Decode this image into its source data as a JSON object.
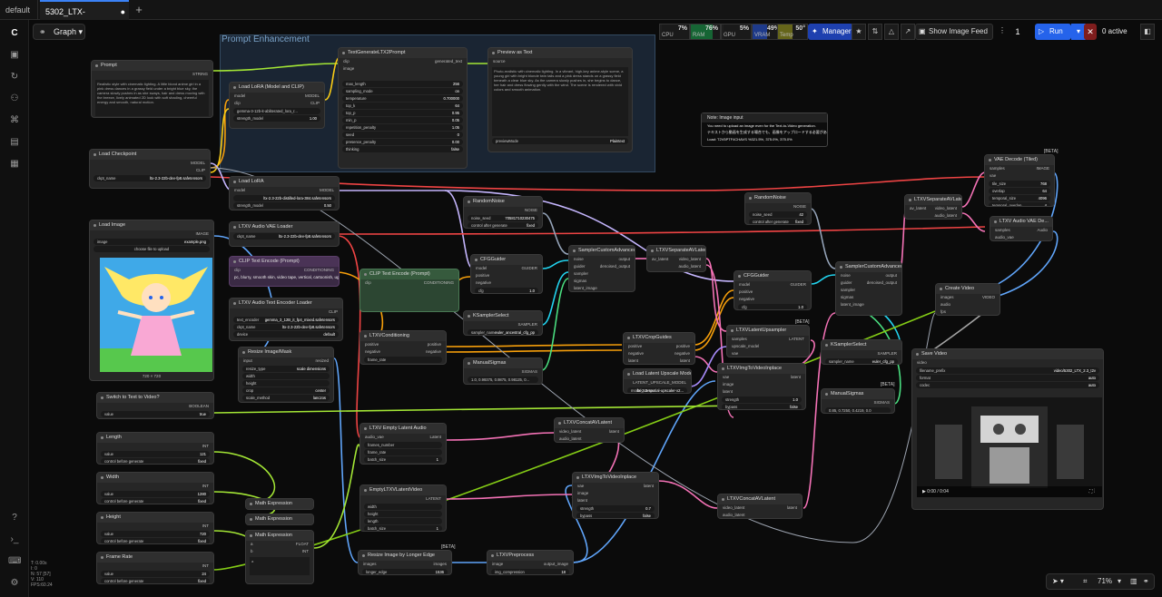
{
  "tabs": {
    "home": "default",
    "workflow": "5302_LTX-2.3_T2V_...",
    "modified_dot": "●",
    "add": "+"
  },
  "toolbar": {
    "graph_label": "Graph",
    "manager_label": "Manager",
    "feed_label": "Show Image Feed",
    "queue_count": "1",
    "run_label": "Run",
    "active_label": "0 active"
  },
  "meters": [
    {
      "label": "CPU",
      "value": "7%",
      "color": "#1f1f1f"
    },
    {
      "label": "RAM",
      "value": "76%",
      "color": "#166534"
    },
    {
      "label": "GPU",
      "value": "5%",
      "color": "#1f1f1f"
    },
    {
      "label": "VRAM",
      "value": "49%",
      "color": "#1e3a8a"
    },
    {
      "label": "Temp",
      "value": "50°",
      "color": "#65651a"
    }
  ],
  "group": {
    "title": "Prompt Enhancement"
  },
  "nodes": {
    "prompt": {
      "title": "Prompt",
      "out": "STRING",
      "text": "Realistic style with cinematic lighting. A little blond anime girl in a pink dress dances in a grassy field under a bright blue sky, the camera slowly pushes in as she sways, hair and dress moving with the breeze, lively animated 2D look with soft shading, cheerful energy and smooth, natural motion."
    },
    "textgen": {
      "title": "TextGenerateLTX2Prompt",
      "in": [
        "clip",
        "image"
      ],
      "out": "generated_text",
      "rows": [
        [
          "max_length",
          "256"
        ],
        [
          "sampling_mode",
          "on"
        ],
        [
          "temperature",
          "0.700000"
        ],
        [
          "top_k",
          "64"
        ],
        [
          "top_p",
          "0.95"
        ],
        [
          "min_p",
          "0.05"
        ],
        [
          "repetition_penalty",
          "1.05"
        ],
        [
          "seed",
          "0"
        ],
        [
          "presence_penalty",
          "0.00"
        ],
        [
          "thinking",
          "false"
        ]
      ]
    },
    "preview": {
      "title": "Preview as Text",
      "in": "source",
      "text": "Photo-realistic with cinematic lighting. In a vibrant, high-key anime-style scene, a young girl with bright blonde twin tails and a pink dress stands on a grassy field beneath a clear blue sky. As the camera slowly pushes in, she begins to dance, her hair and dress flowing gently with the wind. The scene is rendered with vivid colors and smooth animation.",
      "mode": "previewMode",
      "mode_val": "Plaintext"
    },
    "loralora": {
      "title": "Load LoRA (Model and CLIP)",
      "in": [
        "model",
        "clip"
      ],
      "out": [
        "MODEL",
        "CLIP"
      ],
      "lora": "gemma-3-12b-it-abliterated_lora_r...",
      "sm": "strength_model",
      "smv": "1.00",
      "sc": "strength_clip",
      "scv": "1.00"
    },
    "checkpoint": {
      "title": "Load Checkpoint",
      "out": [
        "MODEL",
        "CLIP",
        "VAE"
      ],
      "ckpt": "ckpt_name",
      "ckptv": "ltx-2.3-22b-dev-fp8.safetensors"
    },
    "loadlora": {
      "title": "Load LoRA",
      "in": "model",
      "out": "MODEL",
      "lora": "lora_name",
      "lorav": "ltx-2.3-22b-distilled-lora-384.safetensors",
      "str": "strength_model",
      "strv": "0.50"
    },
    "audiovae": {
      "title": "LTXV Audio VAE Loader",
      "out": "Audio VAE",
      "ckpt": "ckpt_name",
      "ckptv": "ltx-2.3-22b-dev-fp8.safetensors"
    },
    "loadimage": {
      "title": "Load Image",
      "out": [
        "IMAGE",
        "MASK"
      ],
      "image": "image",
      "imagev": "example.png",
      "upload": "choose file to upload",
      "dims": "720 × 720"
    },
    "clipenc": {
      "title": "CLIP Text Encode (Prompt)",
      "in": "clip",
      "out": "CONDITIONING",
      "text": "pc, blurry, smooth skin, video tape, vertical, cartoonish, ugly"
    },
    "clipenc2": {
      "title": "CLIP Text Encode (Prompt)",
      "in": "clip",
      "out": "CONDITIONING"
    },
    "audiotext": {
      "title": "LTXV Audio Text Encoder Loader",
      "out": "CLIP",
      "t1": "text_encoder",
      "t1v": "gemma_3_12B_it_fp4_mixed.safetensors",
      "t2": "ckpt_name",
      "t2v": "ltx-2.3-22b-dev-fp8.safetensors",
      "dev": "device",
      "devv": "default"
    },
    "resize": {
      "title": "Resize Image/Mask",
      "in": "input",
      "out": "resized",
      "rows": [
        [
          "resize_type",
          "scale dimensions"
        ],
        [
          "width",
          ""
        ],
        [
          "height",
          ""
        ],
        [
          "crop",
          "center"
        ],
        [
          "scale_method",
          "lanczos"
        ]
      ]
    },
    "switch": {
      "title": "Switch to Text to Video?",
      "out": "BOOLEAN",
      "val": "value",
      "valv": "true"
    },
    "length": {
      "title": "Length",
      "out": "INT",
      "v": "value",
      "vv": "121",
      "c": "control before generate",
      "cv": "fixed"
    },
    "width": {
      "title": "Width",
      "out": "INT",
      "v": "value",
      "vv": "1280",
      "c": "control before generate",
      "cv": "fixed"
    },
    "height": {
      "title": "Height",
      "out": "INT",
      "v": "value",
      "vv": "720",
      "c": "control before generate",
      "cv": "fixed"
    },
    "framerate": {
      "title": "Frame Rate",
      "out": "INT",
      "v": "value",
      "vv": "24",
      "c": "control before generate",
      "cv": "fixed"
    },
    "noise1": {
      "title": "RandomNoise",
      "out": "NOISE",
      "s": "noise_seed",
      "sv": "70581710230475",
      "c": "control after generate",
      "cv": "fixed"
    },
    "cfg1": {
      "title": "CFGGuider",
      "in": [
        "model",
        "positive",
        "negative"
      ],
      "out": "GUIDER",
      "cfg": "cfg",
      "cfgv": "1.0"
    },
    "ksel1": {
      "title": "KSamplerSelect",
      "out": "SAMPLER",
      "s": "sampler_name",
      "sv": "euler_ancestral_cfg_pp"
    },
    "sigmas1": {
      "title": "ManualSigmas",
      "out": "SIGMAS",
      "s": "1.0, 0.99375, 0.9875, 0.98125, 0..."
    },
    "condition": {
      "title": "LTXVConditioning",
      "in": [
        "positive",
        "negative"
      ],
      "out": [
        "positive",
        "negative"
      ],
      "fr": "frame_rate"
    },
    "sca1": {
      "title": "SamplerCustomAdvanced",
      "in": [
        "noise",
        "guider",
        "sampler",
        "sigmas",
        "latent_image"
      ],
      "out": [
        "output",
        "denoised_output"
      ]
    },
    "sep1": {
      "title": "LTXVSeparateAVLatent",
      "in": "av_latent",
      "out": [
        "video_latent",
        "audio_latent"
      ]
    },
    "crop": {
      "title": "LTXVCropGuides",
      "in": [
        "positive",
        "negative",
        "latent"
      ],
      "out": [
        "positive",
        "negative",
        "latent"
      ]
    },
    "upmodel": {
      "title": "Load Latent Upscale Model",
      "out": "LATENT_UPSCALE_MODEL",
      "m": "model_name",
      "mv": "ltx-2.3-spatial-upscaler-x2..."
    },
    "emptyaudio": {
      "title": "LTXV Empty Latent Audio",
      "in": "audio_vae",
      "out": "Latent",
      "rows": [
        [
          "frames_number",
          ""
        ],
        [
          "frame_rate",
          ""
        ],
        [
          "batch_size",
          "1"
        ]
      ]
    },
    "concat1": {
      "title": "LTXVConcatAVLatent",
      "in": [
        "video_latent",
        "audio_latent"
      ],
      "out": "latent"
    },
    "imgtovid": {
      "title": "LTXVImgToVideoInplace",
      "in": [
        "vae",
        "image",
        "latent"
      ],
      "out": "latent",
      "s": "strength",
      "sv": "0.7",
      "b": "bypass",
      "bv": "false"
    },
    "emptylat": {
      "title": "EmptyLTXVLatentVideo",
      "out": "LATENT",
      "rows": [
        [
          "width",
          ""
        ],
        [
          "height",
          ""
        ],
        [
          "length",
          ""
        ],
        [
          "batch_size",
          "1"
        ]
      ]
    },
    "math1": {
      "title": "Math Expression",
      "in": "a"
    },
    "math2": {
      "title": "Math Expression",
      "in": "a"
    },
    "math3": {
      "title": "Math Expression",
      "in": [
        "a",
        "b"
      ],
      "out": [
        "FLOAT",
        "INT"
      ],
      "expr": "a"
    },
    "resizelong": {
      "title": "Resize Image by Longer Edge",
      "in": "images",
      "out": "images",
      "e": "longer_edge",
      "ev": "1536",
      "badge": "[BETA]"
    },
    "preproc": {
      "title": "LTXVPreprocess",
      "in": "image",
      "out": "output_image",
      "c": "img_compression",
      "cv": "18"
    },
    "noise2": {
      "title": "RandomNoise",
      "out": "NOISE",
      "s": "noise_seed",
      "sv": "42",
      "c": "control after generate",
      "cv": "fixed"
    },
    "cfg2": {
      "title": "CFGGuider",
      "in": [
        "model",
        "positive",
        "negative"
      ],
      "out": "GUIDER",
      "cfg": "cfg",
      "cfgv": "1.0"
    },
    "upsampler": {
      "title": "LTXVLatentUpsampler",
      "in": [
        "samples",
        "upscale_model",
        "vae"
      ],
      "out": "LATENT",
      "badge": "[BETA]"
    },
    "imgtovid2": {
      "title": "LTXVImgToVideoInplace",
      "in": [
        "vae",
        "image",
        "latent"
      ],
      "out": "latent",
      "s": "strength",
      "sv": "1.0",
      "b": "bypass",
      "bv": "false"
    },
    "concat2": {
      "title": "LTXVConcatAVLatent",
      "in": [
        "video_latent",
        "audio_latent"
      ],
      "out": "latent"
    },
    "sca2": {
      "title": "SamplerCustomAdvanced",
      "in": [
        "noise",
        "guider",
        "sampler",
        "sigmas",
        "latent_image"
      ],
      "out": [
        "output",
        "denoised_output"
      ]
    },
    "ksel2": {
      "title": "KSamplerSelect",
      "out": "SAMPLER",
      "s": "sampler_name",
      "sv": "euler_cfg_pp"
    },
    "sigmas2": {
      "title": "ManualSigmas",
      "out": "SIGMAS",
      "s": "0.85, 0.7250, 0.4219, 0.0",
      "badge": "[BETA]"
    },
    "sep2": {
      "title": "LTXVSeparateAVLatent",
      "in": "av_latent",
      "out": [
        "video_latent",
        "audio_latent"
      ]
    },
    "vaedecode": {
      "title": "VAE Decode (Tiled)",
      "in": [
        "samples",
        "vae"
      ],
      "out": "IMAGE",
      "badge": "[BETA]",
      "rows": [
        [
          "tile_size",
          "768"
        ],
        [
          "overlap",
          "64"
        ],
        [
          "temporal_size",
          "4096"
        ],
        [
          "temporal_overlap",
          "4"
        ]
      ]
    },
    "audiodecode": {
      "title": "LTXV Audio VAE De...",
      "in": [
        "samples",
        "audio_vae"
      ],
      "out": "Audio"
    },
    "createvideo": {
      "title": "Create Video",
      "in": [
        "images",
        "audio",
        "fps"
      ],
      "out": "VIDEO"
    },
    "savevideo": {
      "title": "Save Video",
      "in": "video",
      "rows": [
        [
          "filename_prefix",
          "video/5302_LTX_2.3_t2v"
        ],
        [
          "format",
          "auto"
        ],
        [
          "codec",
          "auto"
        ]
      ],
      "time": "0:00 / 0:04"
    },
    "note": {
      "title": "Note: Image input",
      "lines": [
        "You need to upload an image even for the Text-to-Video generation.",
        "テキストから動画を生成する場合でも、画像をアップロードする必要があります。",
        "Load: T2V5PTF4CHAVS     %321.5%, 375.0%, 375.0%"
      ]
    }
  },
  "stats": [
    "T: 0.00s",
    "I: 0",
    "N: 57 [57]",
    "V: 110",
    "FPS:60.24"
  ],
  "zoom": {
    "level": "71%"
  }
}
